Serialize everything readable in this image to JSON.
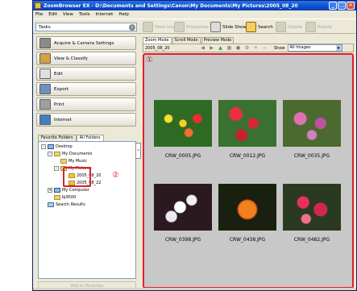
{
  "window": {
    "title": "ZoomBrowser EX  -  D:\\Documents and Settings\\Canon\\My Documents\\My Pictures\\2005_08_20"
  },
  "menu": [
    "File",
    "Edit",
    "View",
    "Tools",
    "Internet",
    "Help"
  ],
  "toolbar": {
    "tasks_label": "Tasks",
    "view_image": "View Image",
    "properties": "Properties",
    "slide_show": "Slide Show",
    "search": "Search",
    "delete": "Delete",
    "rotate": "Rotate"
  },
  "tasks": [
    {
      "label": "Acquire & Camera Settings",
      "icon": "camera-icon"
    },
    {
      "label": "View & Classify",
      "icon": "view-classify-icon"
    },
    {
      "label": "Edit",
      "icon": "edit-icon"
    },
    {
      "label": "Export",
      "icon": "export-icon"
    },
    {
      "label": "Print",
      "icon": "printer-icon"
    },
    {
      "label": "Internet",
      "icon": "globe-icon"
    }
  ],
  "folder_tabs": [
    "Favorite Folders",
    "All Folders"
  ],
  "tree": [
    {
      "label": "Desktop",
      "expander": "-"
    },
    {
      "label": "My Documents",
      "expander": "-"
    },
    {
      "label": "My Music",
      "expander": ""
    },
    {
      "label": "My Pictures",
      "expander": "-"
    },
    {
      "label": "2005_08_20",
      "expander": ""
    },
    {
      "label": "2005_08_22",
      "expander": ""
    },
    {
      "label": "My Computer",
      "expander": "+"
    },
    {
      "label": "bj9500",
      "expander": ""
    },
    {
      "label": "Search Results",
      "expander": ""
    }
  ],
  "add_favorites": "Add to Favorites",
  "mode_tabs": [
    "Zoom Mode",
    "Scroll Mode",
    "Preview Mode"
  ],
  "view": {
    "path": "2005_08_20",
    "show_label": "Show",
    "show_value": "All Images"
  },
  "thumbnails": [
    "CRW_0005.JPG",
    "CRW_0012.JPG",
    "CRW_0035.JPG",
    "CRW_0398.JPG",
    "CRW_0438.JPG",
    "CRW_0482.JPG"
  ],
  "callouts": {
    "one": "①",
    "two": "②"
  },
  "colors": {
    "highlight": "#e0202a",
    "titlebar": "#0a4fd0"
  }
}
